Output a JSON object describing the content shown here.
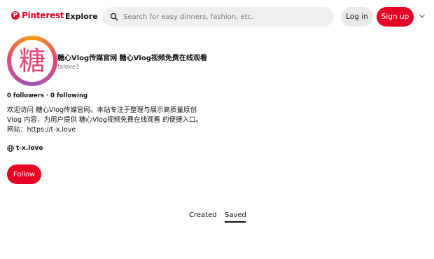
{
  "header": {
    "logo_text": "Pinterest",
    "logo_mark": "P",
    "explore_label": "Explore",
    "search_placeholder": "Search for easy dinners, fashion, etc.",
    "login_label": "Log in",
    "signup_label": "Sign up",
    "icons": {
      "search": "search-icon",
      "more": "chevron-down-icon"
    }
  },
  "profile": {
    "avatar_glyph": "糖",
    "name": "糖心Vlog传媒官网 糖心Vlog视频免费在线观看",
    "username": "txlove1",
    "follow_stats": "0 followers · 0 following",
    "bio_lines": [
      "欢迎访问 糖心Vlog传媒官网。本站专注于整理与展示高质量原创",
      "Vlog 内容，为用户提供 糖心Vlog视频免费在线观看 的便捷入口。",
      "网站：https://t-x.love"
    ],
    "website": "t-x.love",
    "website_icon": "globe-icon",
    "follow_label": "Follow"
  },
  "tabs": [
    {
      "label": "Created",
      "active": false
    },
    {
      "label": "Saved",
      "active": true
    }
  ],
  "colors": {
    "brand_red": "#e60023",
    "search_bg": "#efefef",
    "login_bg": "#e9e9e9",
    "muted_text": "#767676"
  }
}
